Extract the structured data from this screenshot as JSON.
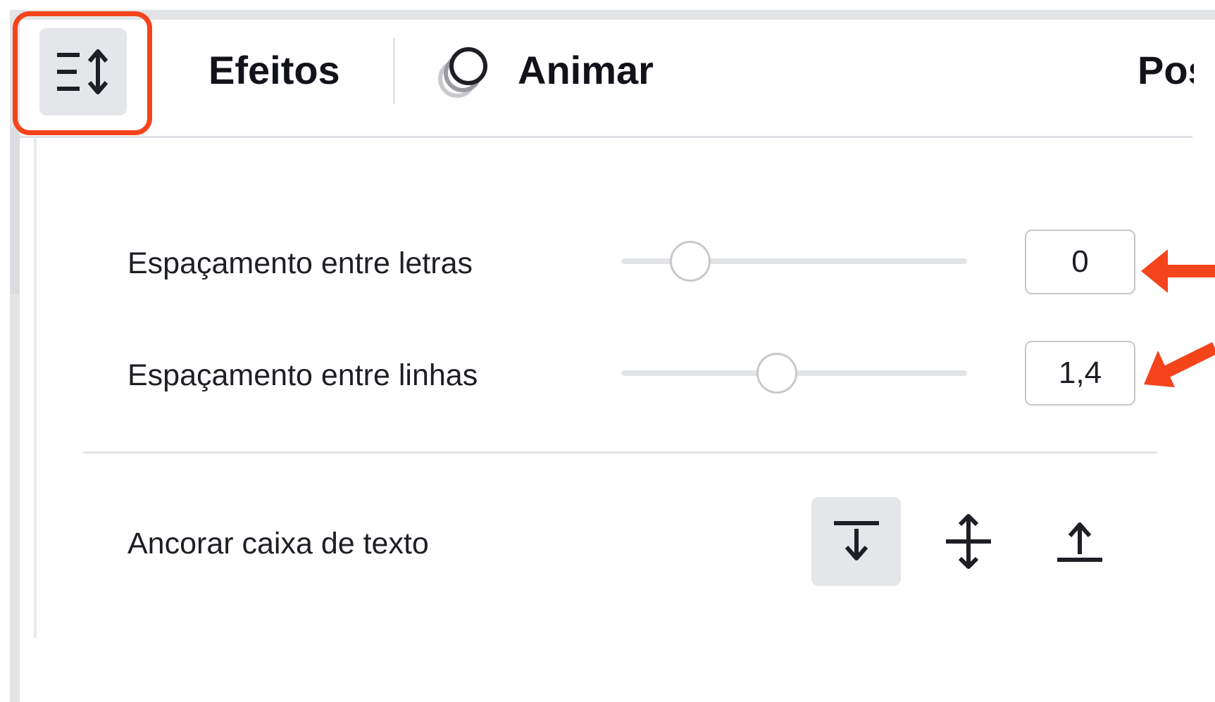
{
  "toolbar": {
    "format_icon": "text-spacing-icon",
    "effects_label": "Efeitos",
    "animate_icon": "animate-icon",
    "animate_label": "Animar",
    "position_label": "Pos"
  },
  "spacing_panel": {
    "letter_spacing": {
      "label": "Espaçamento entre letras",
      "value": "0",
      "slider_fraction": 0.2
    },
    "line_spacing": {
      "label": "Espaçamento entre linhas",
      "value": "1,4",
      "slider_fraction": 0.45
    },
    "anchor": {
      "label": "Ancorar caixa de texto",
      "options": [
        {
          "icon": "anchor-top-icon",
          "selected": true
        },
        {
          "icon": "anchor-middle-icon",
          "selected": false
        },
        {
          "icon": "anchor-bottom-icon",
          "selected": false
        }
      ]
    }
  },
  "annotation_color": "#f4441c"
}
